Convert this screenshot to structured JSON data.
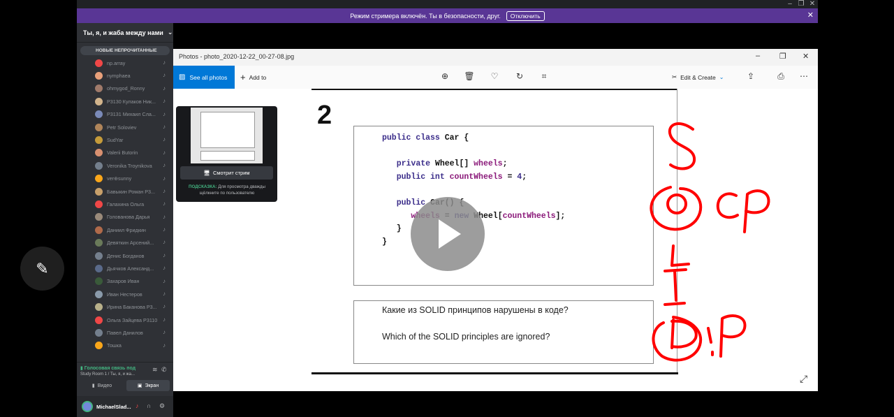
{
  "window_controls": [
    "–",
    "❐",
    "✕"
  ],
  "banner": {
    "text": "Режим стримера включён. Ты в безопасности, друг.",
    "button": "Отключить",
    "close": "✕"
  },
  "sidebar": {
    "server_name": "Ты, я, и жаба между нами",
    "unread_label": "НОВЫЕ НЕПРОЧИТАННЫЕ",
    "users": [
      {
        "name": "np.array",
        "color": "#f04747"
      },
      {
        "name": "nymphaea",
        "color": "#e8a07a"
      },
      {
        "name": "ohmygod_Ronny",
        "color": "#a07a6a"
      },
      {
        "name": "P3130 Кулаков Ник...",
        "color": "#d2b48c"
      },
      {
        "name": "P3131 Михаил Сла...",
        "color": "#7a8ab8"
      },
      {
        "name": "Petr Soloviev",
        "color": "#b0855a"
      },
      {
        "name": "SudYar",
        "color": "#c59b3a"
      },
      {
        "name": "Valerii Butorin",
        "color": "#d89070"
      },
      {
        "name": "Veronika Troynikova",
        "color": "#747f8d"
      },
      {
        "name": "ver⊕sunny",
        "color": "#faa61a"
      },
      {
        "name": "Бавыкин Роман Р3...",
        "color": "#c8a06a"
      },
      {
        "name": "Галахина Ольга",
        "color": "#f04747"
      },
      {
        "name": "Голованова Дарья",
        "color": "#9a8a7a"
      },
      {
        "name": "Даниил Фридкин",
        "color": "#b06a4a"
      },
      {
        "name": "Девяткин Арсений...",
        "color": "#6a7a5a"
      },
      {
        "name": "Денис Богданов",
        "color": "#747f8d"
      },
      {
        "name": "Дьячков Александ...",
        "color": "#5a6a8a"
      },
      {
        "name": "Захаров Иван",
        "color": "#3a5a3a"
      },
      {
        "name": "Иван Нестеров",
        "color": "#8a9aaa"
      },
      {
        "name": "Ирина Баканова Р3...",
        "color": "#b8b08a"
      },
      {
        "name": "Ольга Зайцева Р3110",
        "color": "#f04747"
      },
      {
        "name": "Павел Данилов",
        "color": "#747f8d"
      },
      {
        "name": "Тошка",
        "color": "#faa61a"
      }
    ],
    "voice": {
      "status": "Голосовая связь под",
      "location": "Study Room 1 / Ты, я, и жа...",
      "video_label": "Видео",
      "screen_label": "Экран"
    },
    "me": {
      "name": "MichaelSlad..."
    }
  },
  "photos": {
    "title": "Photos - photo_2020-12-22_00-27-08.jpg",
    "see_all": "See all photos",
    "add_to": "Add to",
    "edit_create": "Edit & Create",
    "toolbar_icons": [
      "zoom-icon",
      "delete-icon",
      "favorite-icon",
      "rotate-icon",
      "crop-icon",
      "share-icon",
      "print-icon",
      "more-icon"
    ],
    "slide": {
      "number": "2",
      "code": [
        "public class Car {",
        "",
        "   private Wheel[] wheels;",
        "   public int countWheels = 4;",
        "",
        "   public Car() {",
        "      wheels = new Wheel[countWheels];",
        "   }",
        "}"
      ],
      "question_ru": "Какие из SOLID принципов нарушены в коде?",
      "question_en": "Which of the SOLID principles are ignored?",
      "annotations": {
        "letters": [
          "S",
          "O",
          "L",
          "I",
          "D"
        ],
        "o_note": "CP",
        "d_note": "!P",
        "color": "#ff0000"
      }
    }
  },
  "preview": {
    "watch_button": "Смотрит стрим",
    "hint_bold": "ПОДСКАЗКА:",
    "hint_text": "Для просмотра дважды щёлкните по пользователю"
  }
}
